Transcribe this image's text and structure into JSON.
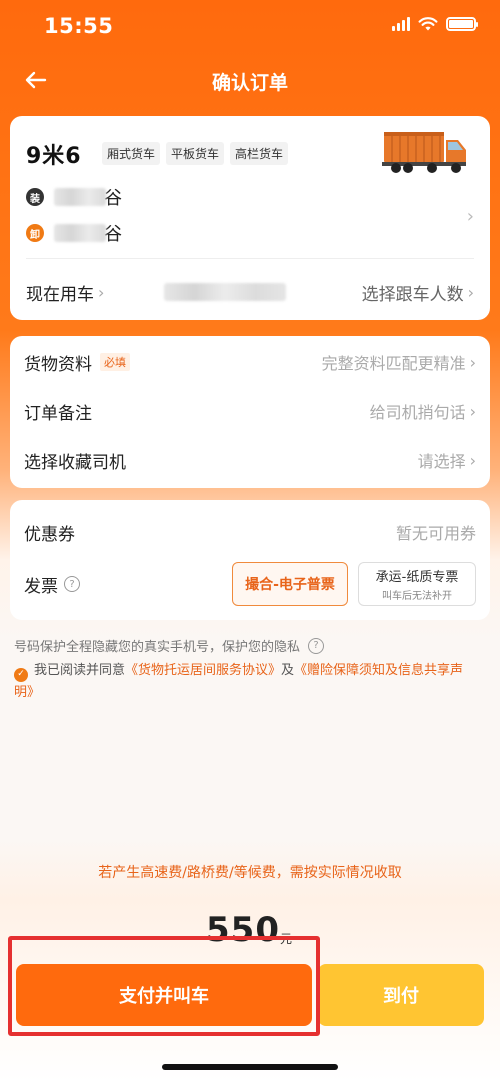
{
  "status_bar": {
    "time": "15:55"
  },
  "header": {
    "title": "确认订单"
  },
  "vehicle": {
    "size": "9米6",
    "tags": [
      "厢式货车",
      "平板货车",
      "高栏货车"
    ]
  },
  "addresses": [
    {
      "badge": "装",
      "suffix": "谷"
    },
    {
      "badge": "卸",
      "suffix": "谷"
    }
  ],
  "use_car": {
    "label": "现在用车",
    "people_label": "选择跟车人数"
  },
  "cargo": {
    "label": "货物资料",
    "required": "必填",
    "value": "完整资料匹配更精准"
  },
  "remark": {
    "label": "订单备注",
    "value": "给司机捎句话"
  },
  "favorite_driver": {
    "label": "选择收藏司机",
    "value": "请选择"
  },
  "coupon": {
    "label": "优惠券",
    "value": "暂无可用券"
  },
  "invoice": {
    "label": "发票",
    "option1": "撮合-电子普票",
    "option2_main": "承运-纸质专票",
    "option2_sub": "叫车后无法补开"
  },
  "privacy_text": "号码保护全程隐藏您的真实手机号，保护您的隐私",
  "agreement": {
    "prefix": "我已阅读并同意",
    "link1": "《货物托运居间服务协议》",
    "middle": "及",
    "link2": "《赠险保障须知及信息共享声明》"
  },
  "fee_note": "若产生高速费/路桥费/等候费，需按实际情况收取",
  "price": {
    "amount": "550",
    "unit": "元"
  },
  "buttons": {
    "pay": "支付并叫车",
    "cod": "到付"
  },
  "colors": {
    "brand": "#ff6a0d",
    "cod": "#ffc532",
    "highlight": "#e53030"
  }
}
